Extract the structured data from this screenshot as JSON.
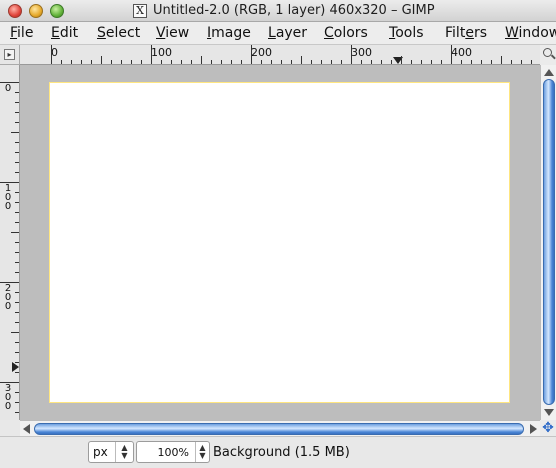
{
  "window": {
    "title": "Untitled-2.0 (RGB, 1 layer) 460x320 – GIMP",
    "x_icon": "X"
  },
  "menu": [
    {
      "mnemonic": "F",
      "rest": "ile"
    },
    {
      "mnemonic": "E",
      "rest": "dit"
    },
    {
      "mnemonic": "S",
      "rest": "elect"
    },
    {
      "mnemonic": "V",
      "rest": "iew"
    },
    {
      "mnemonic": "I",
      "rest": "mage"
    },
    {
      "mnemonic": "L",
      "rest": "ayer"
    },
    {
      "mnemonic": "C",
      "rest": "olors"
    },
    {
      "mnemonic": "T",
      "rest": "ools"
    },
    {
      "pre": "Filt",
      "mnemonic": "e",
      "rest": "rs"
    },
    {
      "mnemonic": "W",
      "rest": "indows"
    }
  ],
  "rulers": {
    "horizontal_labels": [
      "0",
      "100",
      "200",
      "300",
      "400"
    ],
    "vertical_labels": [
      "0",
      "100",
      "200",
      "300"
    ]
  },
  "statusbar": {
    "unit": "px",
    "zoom": "100%",
    "status_text": "Background (1.5 MB)"
  },
  "icons": {
    "corner": "quick-mask-toggle-icon",
    "zoom": "zoom-magnifier-icon",
    "navigate": "navigate-cross-icon"
  }
}
